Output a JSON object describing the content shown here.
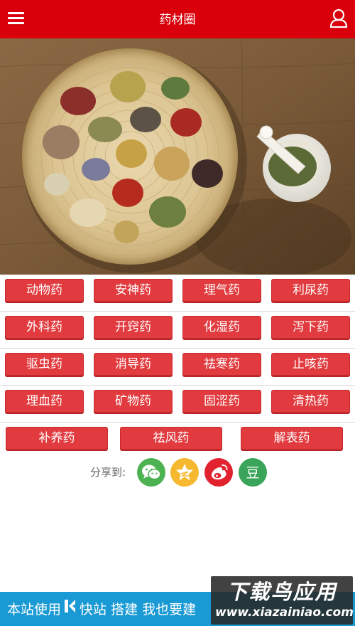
{
  "header": {
    "title": "药材圈",
    "menu_icon": "hamburger-menu-icon",
    "user_icon": "user-icon",
    "bg_color": "#d9000b"
  },
  "banner": {
    "image": "herbs-on-bamboo-tray-with-mortar"
  },
  "categories": [
    [
      "动物药",
      "安神药",
      "理气药",
      "利尿药"
    ],
    [
      "外科药",
      "开窍药",
      "化湿药",
      "泻下药"
    ],
    [
      "驱虫药",
      "消导药",
      "祛寒药",
      "止咳药"
    ],
    [
      "理血药",
      "矿物药",
      "固涩药",
      "清热药"
    ],
    [
      "补养药",
      "祛风药",
      "解表药"
    ]
  ],
  "share": {
    "label": "分享到:",
    "items": [
      {
        "name": "wechat",
        "icon": "wechat-icon",
        "color": "#4db352"
      },
      {
        "name": "qzone",
        "icon": "qzone-star-icon",
        "color": "#f5b82e"
      },
      {
        "name": "weibo",
        "icon": "weibo-icon",
        "color": "#e2232f"
      },
      {
        "name": "douban",
        "icon": "douban-icon",
        "color": "#3aa55a",
        "glyph": "豆"
      }
    ]
  },
  "footer": {
    "prefix": "本站使用",
    "brand": "快站",
    "suffix": "搭建 我也要建",
    "bg_color": "#1a9ad4"
  },
  "watermark": {
    "line1": "下载鸟应用",
    "line2": "www.xiazainiao.com"
  }
}
